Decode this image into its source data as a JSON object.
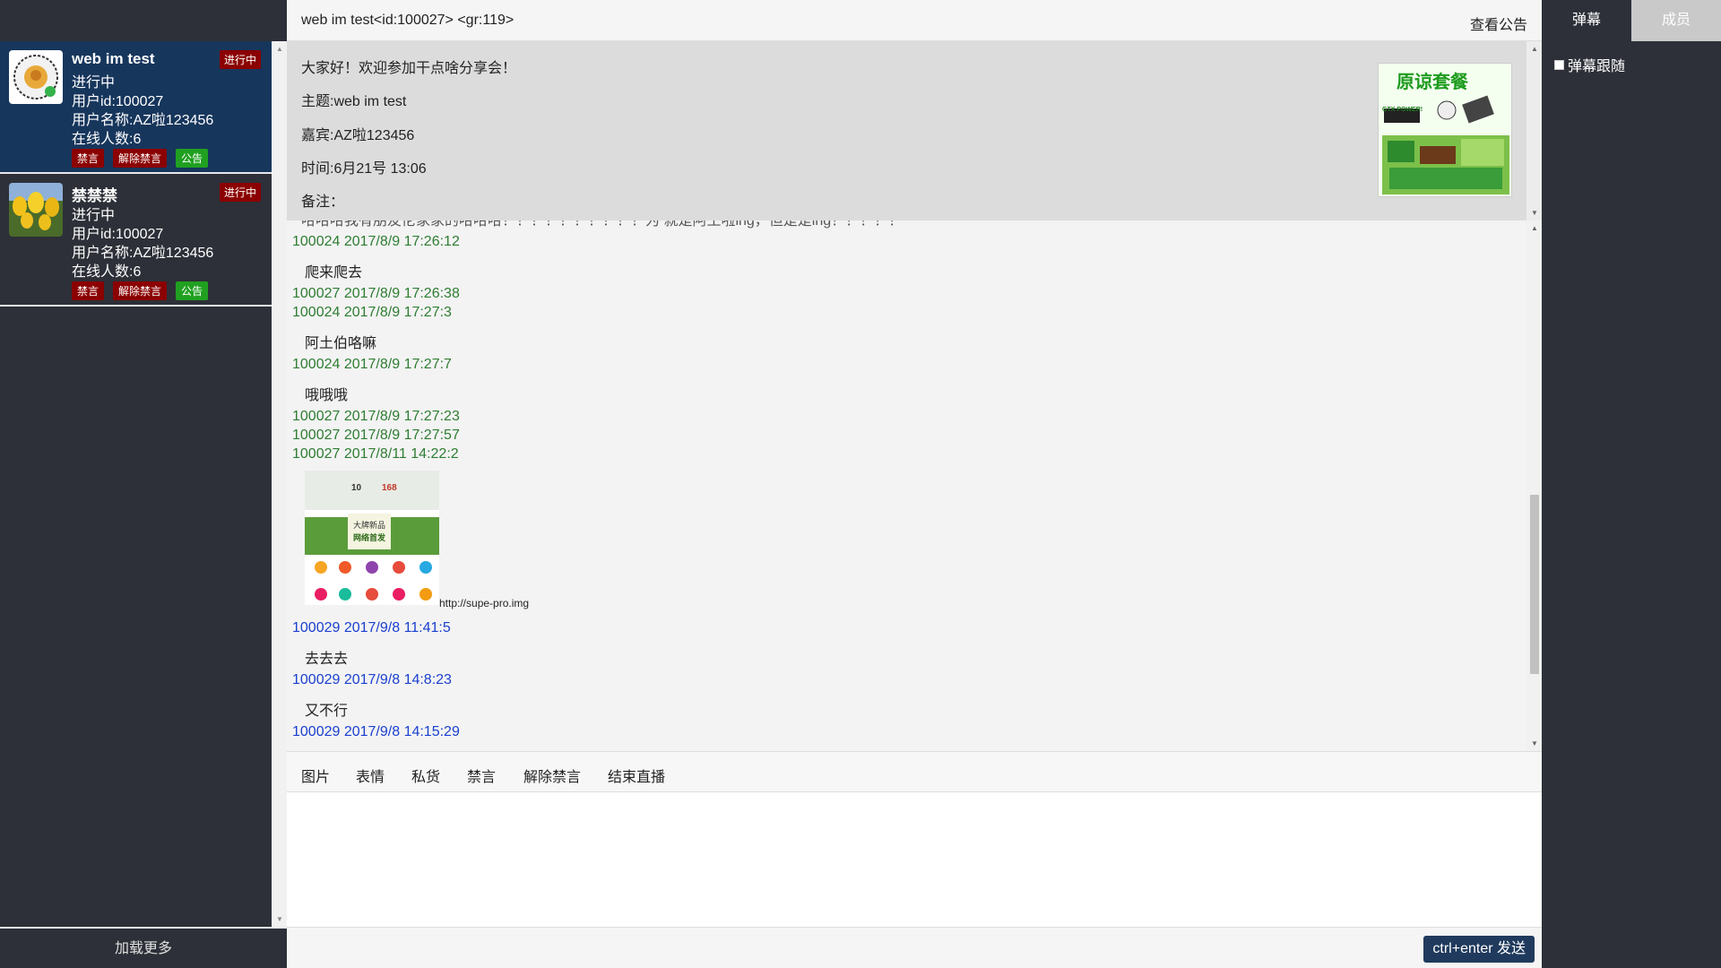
{
  "sidebar": {
    "rooms": [
      {
        "title": "web im test",
        "state": "进行中",
        "badge": "进行中",
        "user_id": "用户id:100027",
        "user_name": "用户名称:AZ啦123456",
        "online": "在线人数:6",
        "actions": [
          "禁言",
          "解除禁言",
          "公告"
        ],
        "avatar_icon": "qr-code-icon"
      },
      {
        "title": "禁禁禁",
        "state": "进行中",
        "badge": "进行中",
        "user_id": "用户id:100027",
        "user_name": "用户名称:AZ啦123456",
        "online": "在线人数:6",
        "actions": [
          "禁言",
          "解除禁言",
          "公告"
        ],
        "avatar_icon": "tulip-image-icon"
      }
    ],
    "load_more": "加载更多"
  },
  "header": {
    "title": "web im test<id:100027> <gr:119>",
    "notice_link": "查看公告"
  },
  "announcement": {
    "welcome": "大家好！欢迎参加干点啥分享会！",
    "topic": "主题:web im test",
    "guest": "嘉宾:AZ啦123456",
    "time": "时间:6月21号 13:06",
    "note": "备注：",
    "promo_text": "原谅套餐",
    "promo_sub": "GTX POWER!"
  },
  "messages": {
    "cut_text": "哈哈哈我有朋友伦家家的哈哈哈！！！！！！！！！！为 就是阿土啦ing，但是是ing！！！！！",
    "items": [
      {
        "meta": "100024 2017/8/9 17:26:12",
        "text": "爬来爬去"
      },
      {
        "meta": "100027 2017/8/9 17:26:38",
        "text": ""
      },
      {
        "meta": "100024 2017/8/9 17:27:3",
        "text": "阿土伯咯嘛"
      },
      {
        "meta": "100024 2017/8/9 17:27:7",
        "text": "哦哦哦"
      },
      {
        "meta": "100027 2017/8/9 17:27:23",
        "text": ""
      },
      {
        "meta": "100027 2017/8/9 17:27:57",
        "text": ""
      },
      {
        "meta": "100027 2017/8/11 14:22:2",
        "text": ""
      },
      {
        "meta": "100029 2017/9/8 11:41:5",
        "text": "去去去"
      },
      {
        "meta": "100029 2017/9/8 14:8:23",
        "text": "又不行"
      },
      {
        "meta": "100029 2017/9/8 14:15:29",
        "text": ""
      }
    ],
    "image_caption": "http://supe-pro.img",
    "image_banner_a": "10",
    "image_banner_b": "168",
    "image_banner_c": "大牌新品",
    "image_banner_d": "网络首发"
  },
  "toolbar": {
    "buttons": [
      "图片",
      "表情",
      "私货",
      "禁言",
      "解除禁言",
      "结束直播"
    ]
  },
  "composer": {
    "value": "",
    "send_label": "ctrl+enter 发送"
  },
  "right_panel": {
    "tabs": [
      "弹幕",
      "成员"
    ],
    "follow_label": "弹幕跟随"
  },
  "colors": {
    "sidebar_bg": "#2d3038",
    "active_room": "#17365c",
    "badge_red": "#8b0000",
    "tag_green": "#20a020",
    "meta_green": "#2e7d32",
    "meta_blue": "#1a3fcf",
    "send_btn": "#1f3a5c"
  }
}
